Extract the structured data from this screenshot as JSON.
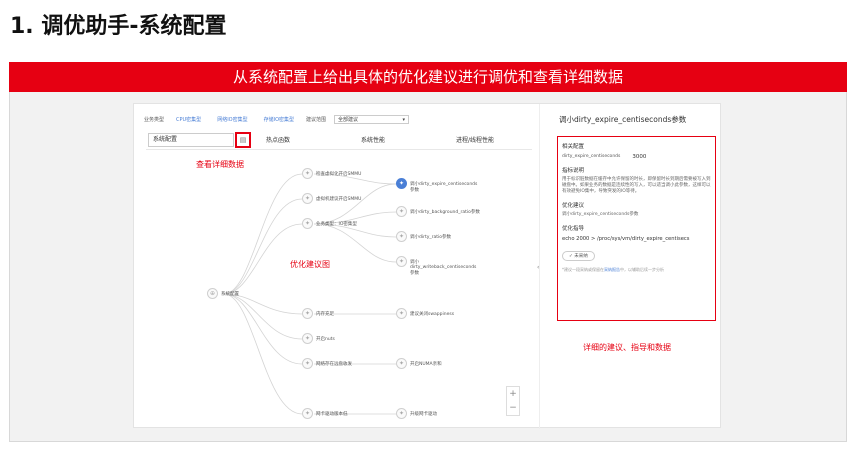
{
  "slide": {
    "title": "1. 调优助手-系统配置",
    "banner": "从系统配置上给出具体的优化建议进行调优和查看详细数据"
  },
  "filters": {
    "business_type_label": "业务类型",
    "chips": [
      "CPU密集型",
      "网络IO密集型",
      "存储IO密集型"
    ],
    "scope_label": "建议范围",
    "scope_value": "全部建议"
  },
  "tabs": [
    "系统配置",
    "热点函数",
    "系统性能",
    "进程/线程性能"
  ],
  "annotations": {
    "view_detail": "查看详细数据",
    "optimization_map": "优化建议图",
    "detail_guide": "详细的建议、指导和数据"
  },
  "tree": {
    "root": "系统配置",
    "branches": [
      {
        "label": "检查虚拟化开启SMMU"
      },
      {
        "label": "虚拟机建议开启SMMU"
      },
      {
        "label": "业务类型：IO密集型"
      },
      {
        "label": "内存充足"
      },
      {
        "label": "开启nuts"
      },
      {
        "label": "网络存在远盘收发"
      },
      {
        "label": "网卡驱动版本低"
      }
    ],
    "leaves": [
      {
        "label": "调小dirty_expire_centiseconds参数",
        "active": true
      },
      {
        "label": "调小dirty_background_ratio参数"
      },
      {
        "label": "调小dirty_ratio参数"
      },
      {
        "label": "调小dirty_writeback_centiseconds参数"
      },
      {
        "label": "建议关闭swappiness"
      },
      {
        "label": "开启NUMA亲和"
      },
      {
        "label": "升级网卡驱动"
      }
    ]
  },
  "zoom": {
    "plus": "+",
    "minus": "−"
  },
  "detail": {
    "title": "调小dirty_expire_centiseconds参数",
    "config_header": "相关配置",
    "config_key": "dirty_expire_centiseconds",
    "config_value": "3000",
    "desc_header": "指标说明",
    "desc_text": "用于标识脏数据在缓存中允许保留的时长，即保留时长到期后需要被写入到磁盘中。如果业务的数据是连续性的写入，可以适当调小此参数，这样可以有效避免IO集中，导致突发的IO等待。",
    "suggest_header": "优化建议",
    "suggest_text": "调小dirty_expire_centiseconds参数",
    "guide_header": "优化指导",
    "guide_cmd": "echo 2000 > /proc/sys/vm/dirty_expire_centisecs",
    "collect_button": "未采纳",
    "foot_prefix": "*建议一段采纳或保留在",
    "foot_link": "采纳报告",
    "foot_suffix": "中，以辅助后续一步分析"
  },
  "colors": {
    "accent": "#e60012",
    "link": "#4a7fd6"
  },
  "icons": [
    "bulb-icon",
    "document-icon",
    "plus-icon",
    "minus-icon",
    "chevron-left-icon"
  ]
}
